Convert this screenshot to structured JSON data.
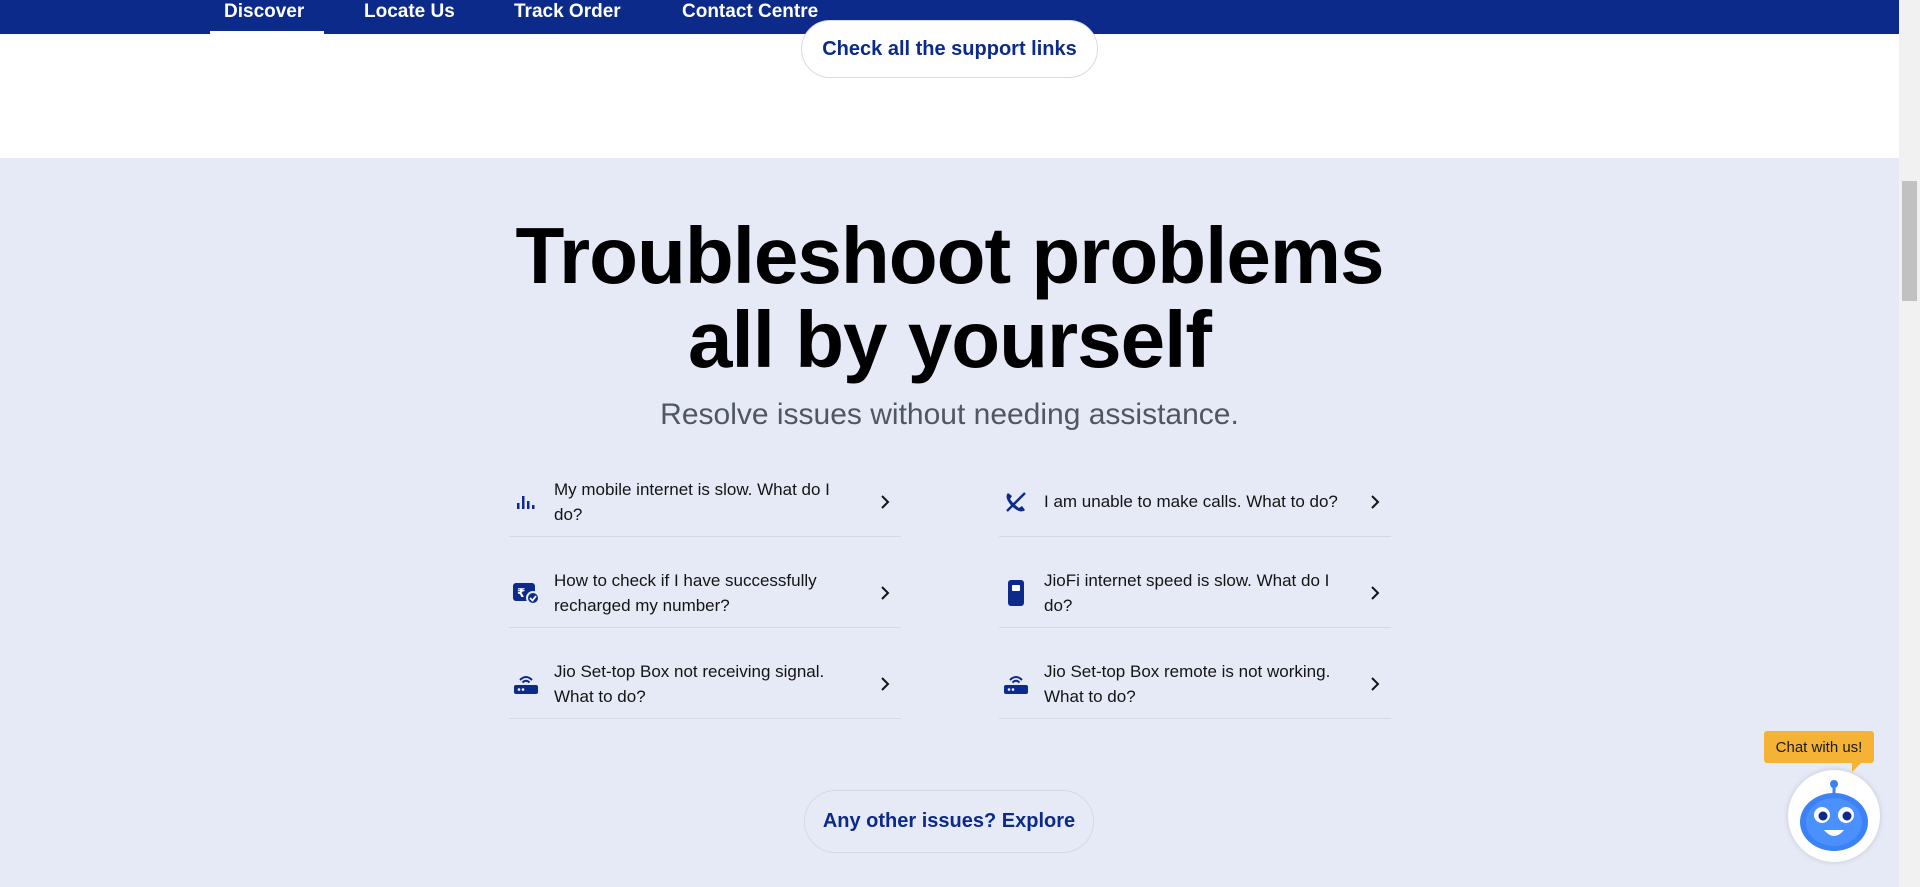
{
  "nav": {
    "items": [
      {
        "label": "Discover",
        "active": true
      },
      {
        "label": "Locate Us",
        "active": false
      },
      {
        "label": "Track Order",
        "active": false
      },
      {
        "label": "Contact Centre",
        "active": false
      }
    ]
  },
  "support": {
    "link_label": "Check all the support links"
  },
  "troubleshoot": {
    "title_line1": "Troubleshoot problems",
    "title_line2": "all by yourself",
    "subtitle": "Resolve issues without needing assistance.",
    "items": [
      {
        "label": "My mobile internet is slow. What do I do?",
        "icon": "signal-bars-icon"
      },
      {
        "label": "I am unable to make calls. What to do?",
        "icon": "call-blocked-icon"
      },
      {
        "label": "How to check if I have successfully recharged my number?",
        "icon": "recharge-check-icon"
      },
      {
        "label": "JioFi internet speed is slow. What do I do?",
        "icon": "jiofi-device-icon"
      },
      {
        "label": "Jio Set-top Box not receiving signal. What to do?",
        "icon": "set-top-box-icon"
      },
      {
        "label": "Jio Set-top Box remote is not working. What to do?",
        "icon": "set-top-box-icon"
      }
    ],
    "explore_label": "Any other issues? Explore"
  },
  "chat": {
    "bubble_label": "Chat with us!"
  },
  "colors": {
    "brand_blue": "#0b2a8a",
    "section_bg": "#e6eaf6",
    "chat_yellow": "#f5b335",
    "bot_blue": "#3b82f6"
  }
}
